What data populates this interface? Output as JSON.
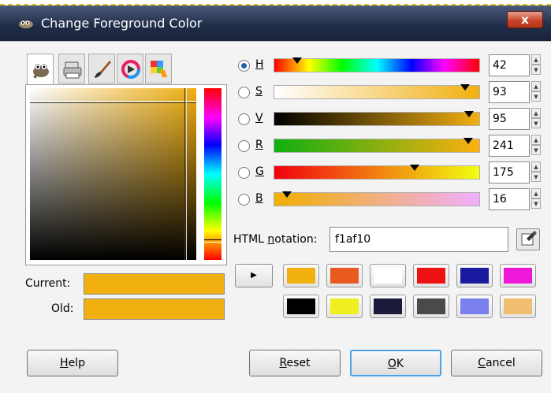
{
  "window": {
    "title": "Change Foreground Color",
    "close_label": "x"
  },
  "tabs": [
    {
      "name": "tab-gimp",
      "icon": "gimp-wilber-icon",
      "active": true
    },
    {
      "name": "tab-cmyk",
      "icon": "printer-icon"
    },
    {
      "name": "tab-watercolor",
      "icon": "paintbrush-icon"
    },
    {
      "name": "tab-wheel",
      "icon": "color-wheel-icon"
    },
    {
      "name": "tab-palette",
      "icon": "palette-icon"
    }
  ],
  "current_label": "Current:",
  "old_label": "Old:",
  "current_color": "#f1af10",
  "old_color": "#f1af10",
  "channels": {
    "h": {
      "label": "H",
      "value": "42",
      "fraction": 0.11
    },
    "s": {
      "label": "S",
      "value": "93",
      "fraction": 0.93
    },
    "v": {
      "label": "V",
      "value": "95",
      "fraction": 0.95
    },
    "r": {
      "label": "R",
      "value": "241",
      "fraction": 0.945
    },
    "g": {
      "label": "G",
      "value": "175",
      "fraction": 0.686
    },
    "b": {
      "label": "B",
      "value": "16",
      "fraction": 0.063
    }
  },
  "html_notation": {
    "label_prefix": "HTML ",
    "label_underlined": "n",
    "label_suffix": "otation:",
    "value": "f1af10"
  },
  "history_colors": [
    "#f1af10",
    "#e85a20",
    "#ffffff",
    "#ee1111",
    "#1a1aa0",
    "#ee18d8",
    "#000000",
    "#f0f020",
    "#1a1a3a",
    "#4a4a4a",
    "#7a80ee",
    "#f0c070"
  ],
  "buttons": {
    "help": {
      "u": "H",
      "rest": "elp"
    },
    "reset": {
      "u": "R",
      "rest": "eset"
    },
    "ok": {
      "u": "O",
      "rest": "K"
    },
    "cancel": {
      "u": "C",
      "rest": "ancel"
    }
  }
}
